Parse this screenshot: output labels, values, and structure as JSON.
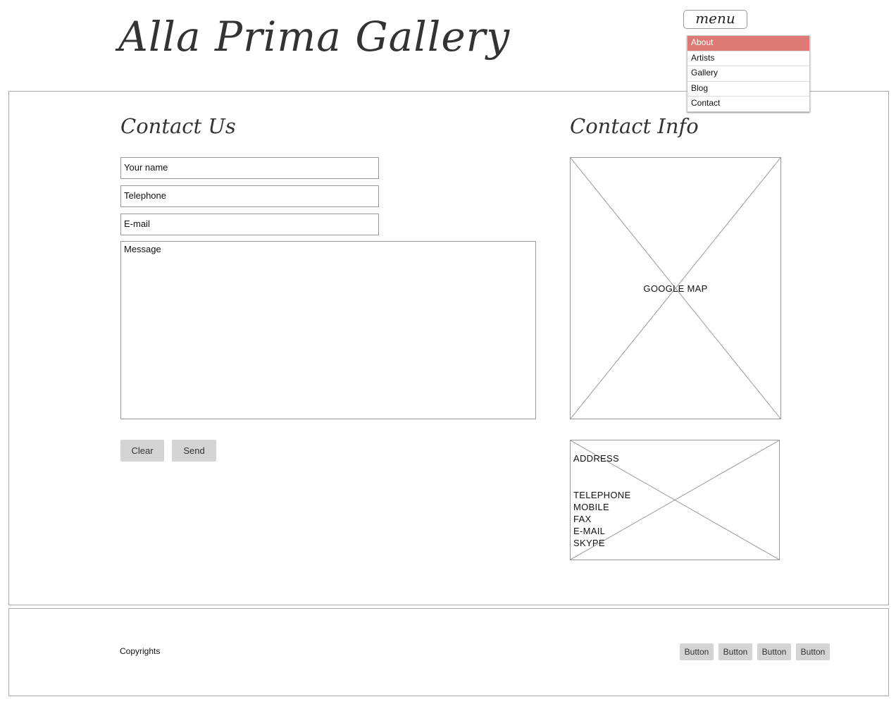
{
  "header": {
    "logo": "Alla Prima Gallery",
    "menu_label": "menu",
    "menu_items": [
      {
        "label": "About",
        "active": true
      },
      {
        "label": "Artists"
      },
      {
        "label": "Gallery"
      },
      {
        "label": "Blog"
      },
      {
        "label": "Contact"
      }
    ]
  },
  "contact_form": {
    "title": "Contact Us",
    "name_placeholder": "Your name",
    "telephone_placeholder": "Telephone",
    "email_placeholder": "E-mail",
    "message_placeholder": "Message",
    "clear_label": "Clear",
    "send_label": "Send"
  },
  "contact_info": {
    "title": "Contact Info",
    "map_label": "GOOGLE MAP",
    "address_label": "ADDRESS",
    "details": [
      "TELEPHONE",
      "MOBILE",
      "FAX",
      "E-MAIL",
      "SKYPE"
    ]
  },
  "footer": {
    "copyright": "Copyrights",
    "buttons": [
      "Button",
      "Button",
      "Button",
      "Button"
    ]
  },
  "colors": {
    "menu_active": "#dc7b75",
    "button_bg": "#d4d4d4"
  }
}
